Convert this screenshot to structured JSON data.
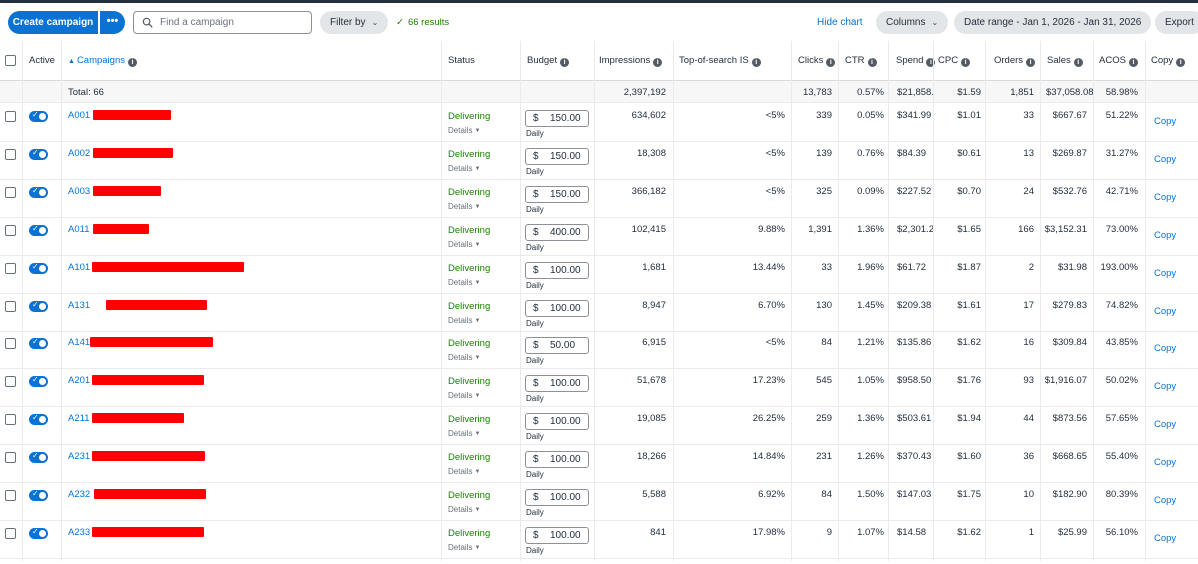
{
  "toolbar": {
    "create_label": "Create campaign",
    "more_label": "•••",
    "search_placeholder": "Find a campaign",
    "filter_label": "Filter by",
    "results_label": "66 results",
    "hide_chart_label": "Hide chart",
    "columns_label": "Columns",
    "date_range_label": "Date range - Jan 1, 2026 - Jan 31, 2026",
    "export_label": "Export"
  },
  "headers": {
    "active": "Active",
    "campaigns": "Campaigns",
    "status": "Status",
    "budget": "Budget",
    "impressions": "Impressions",
    "tos": "Top-of-search IS",
    "clicks": "Clicks",
    "ctr": "CTR",
    "spend": "Spend",
    "cpc": "CPC",
    "orders": "Orders",
    "sales": "Sales",
    "acos": "ACOS",
    "copy": "Copy"
  },
  "totals": {
    "label": "Total: 66",
    "impressions": "2,397,192",
    "clicks": "13,783",
    "ctr": "0.57%",
    "spend": "$21,858.",
    "cpc": "$1.59",
    "orders": "1,851",
    "sales": "$37,058.08",
    "acos": "58.98%"
  },
  "row_common": {
    "status": "Delivering",
    "details": "Details",
    "currency": "$",
    "daily": "Daily",
    "copy": "Copy"
  },
  "rows": [
    {
      "name": "A001",
      "budget": "150.00",
      "impressions": "634,602",
      "tos": "<5%",
      "clicks": "339",
      "ctr": "0.05%",
      "spend": "$341.99",
      "cpc": "$1.01",
      "orders": "33",
      "sales": "$667.67",
      "acos": "51.22%"
    },
    {
      "name": "A002",
      "budget": "150.00",
      "impressions": "18,308",
      "tos": "<5%",
      "clicks": "139",
      "ctr": "0.76%",
      "spend": "$84.39",
      "cpc": "$0.61",
      "orders": "13",
      "sales": "$269.87",
      "acos": "31.27%"
    },
    {
      "name": "A003",
      "budget": "150.00",
      "impressions": "366,182",
      "tos": "<5%",
      "clicks": "325",
      "ctr": "0.09%",
      "spend": "$227.52",
      "cpc": "$0.70",
      "orders": "24",
      "sales": "$532.76",
      "acos": "42.71%"
    },
    {
      "name": "A011",
      "budget": "400.00",
      "impressions": "102,415",
      "tos": "9.88%",
      "clicks": "1,391",
      "ctr": "1.36%",
      "spend": "$2,301.2",
      "cpc": "$1.65",
      "orders": "166",
      "sales": "$3,152.31",
      "acos": "73.00%"
    },
    {
      "name": "A101",
      "budget": "100.00",
      "impressions": "1,681",
      "tos": "13.44%",
      "clicks": "33",
      "ctr": "1.96%",
      "spend": "$61.72",
      "cpc": "$1.87",
      "orders": "2",
      "sales": "$31.98",
      "acos": "193.00%"
    },
    {
      "name": "A131",
      "budget": "100.00",
      "impressions": "8,947",
      "tos": "6.70%",
      "clicks": "130",
      "ctr": "1.45%",
      "spend": "$209.38",
      "cpc": "$1.61",
      "orders": "17",
      "sales": "$279.83",
      "acos": "74.82%"
    },
    {
      "name": "A141",
      "budget": "50.00",
      "impressions": "6,915",
      "tos": "<5%",
      "clicks": "84",
      "ctr": "1.21%",
      "spend": "$135.86",
      "cpc": "$1.62",
      "orders": "16",
      "sales": "$309.84",
      "acos": "43.85%"
    },
    {
      "name": "A201",
      "budget": "100.00",
      "impressions": "51,678",
      "tos": "17.23%",
      "clicks": "545",
      "ctr": "1.05%",
      "spend": "$958.50",
      "cpc": "$1.76",
      "orders": "93",
      "sales": "$1,916.07",
      "acos": "50.02%"
    },
    {
      "name": "A211",
      "budget": "100.00",
      "impressions": "19,085",
      "tos": "26.25%",
      "clicks": "259",
      "ctr": "1.36%",
      "spend": "$503.61",
      "cpc": "$1.94",
      "orders": "44",
      "sales": "$873.56",
      "acos": "57.65%"
    },
    {
      "name": "A231",
      "budget": "100.00",
      "impressions": "18,266",
      "tos": "14.84%",
      "clicks": "231",
      "ctr": "1.26%",
      "spend": "$370.43",
      "cpc": "$1.60",
      "orders": "36",
      "sales": "$668.65",
      "acos": "55.40%"
    },
    {
      "name": "A232",
      "budget": "100.00",
      "impressions": "5,588",
      "tos": "6.92%",
      "clicks": "84",
      "ctr": "1.50%",
      "spend": "$147.03",
      "cpc": "$1.75",
      "orders": "10",
      "sales": "$182.90",
      "acos": "80.39%"
    },
    {
      "name": "A233",
      "budget": "100.00",
      "impressions": "841",
      "tos": "17.98%",
      "clicks": "9",
      "ctr": "1.07%",
      "spend": "$14.58",
      "cpc": "$1.62",
      "orders": "1",
      "sales": "$25.99",
      "acos": "56.10%"
    }
  ],
  "colors": {
    "primary": "#0972d3",
    "delivering": "#1d8102",
    "redaction": "#ff0000",
    "pill_bg": "#e3e6e8"
  }
}
